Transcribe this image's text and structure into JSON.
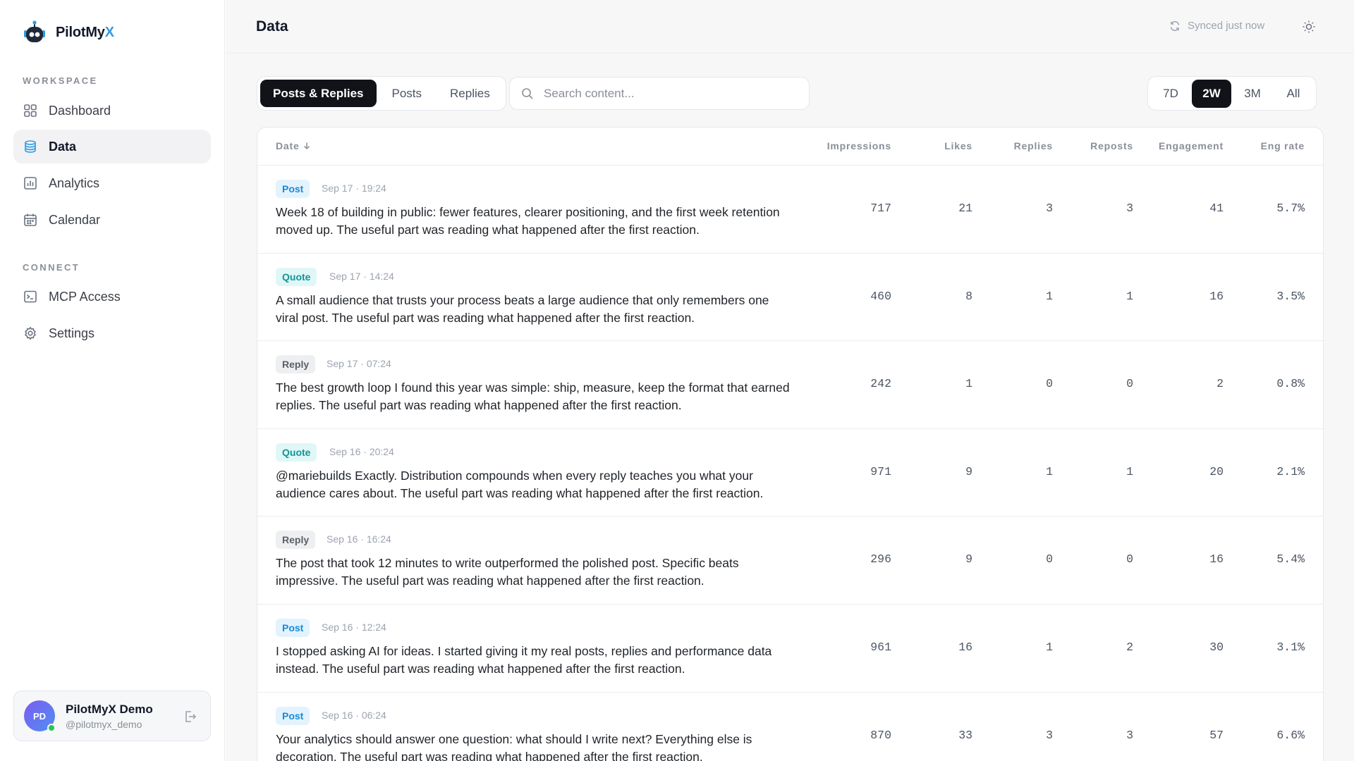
{
  "app": {
    "name_main": "PilotMy",
    "name_accent": "X",
    "accent_color": "#2d9be3"
  },
  "sidebar": {
    "workspace_label": "WORKSPACE",
    "connect_label": "CONNECT",
    "items": [
      {
        "label": "Dashboard",
        "icon": "grid-icon"
      },
      {
        "label": "Data",
        "icon": "database-icon",
        "active": true
      },
      {
        "label": "Analytics",
        "icon": "bar-chart-icon"
      },
      {
        "label": "Calendar",
        "icon": "calendar-icon"
      },
      {
        "label": "MCP Access",
        "icon": "terminal-icon"
      },
      {
        "label": "Settings",
        "icon": "gear-icon"
      }
    ],
    "user": {
      "initials": "PD",
      "name": "PilotMyX Demo",
      "handle": "@pilotmyx_demo",
      "status": "online"
    }
  },
  "header": {
    "title": "Data",
    "sync_status": "Synced just now"
  },
  "filters": {
    "tabs": [
      "Posts & Replies",
      "Posts",
      "Replies"
    ],
    "active_tab": "Posts & Replies",
    "search_placeholder": "Search content...",
    "search_value": "",
    "ranges": [
      "7D",
      "2W",
      "3M",
      "All"
    ],
    "active_range": "2W"
  },
  "table": {
    "columns": {
      "date": "Date",
      "impressions": "Impressions",
      "likes": "Likes",
      "replies": "Replies",
      "reposts": "Reposts",
      "engagement": "Engagement",
      "eng_rate": "Eng rate"
    },
    "sort": "date-desc",
    "rows": [
      {
        "type": "Post",
        "time": "Sep 17 · 19:24",
        "text": "Week 18 of building in public: fewer features, clearer positioning, and the first week retention moved up. The useful part was reading what happened after the first reaction.",
        "impressions": "717",
        "likes": "21",
        "replies": "3",
        "reposts": "3",
        "engagement": "41",
        "eng_rate": "5.7%"
      },
      {
        "type": "Quote",
        "time": "Sep 17 · 14:24",
        "text": "A small audience that trusts your process beats a large audience that only remembers one viral post. The useful part was reading what happened after the first reaction.",
        "impressions": "460",
        "likes": "8",
        "replies": "1",
        "reposts": "1",
        "engagement": "16",
        "eng_rate": "3.5%"
      },
      {
        "type": "Reply",
        "time": "Sep 17 · 07:24",
        "text": "The best growth loop I found this year was simple: ship, measure, keep the format that earned replies. The useful part was reading what happened after the first reaction.",
        "impressions": "242",
        "likes": "1",
        "replies": "0",
        "reposts": "0",
        "engagement": "2",
        "eng_rate": "0.8%"
      },
      {
        "type": "Quote",
        "time": "Sep 16 · 20:24",
        "text": "@mariebuilds Exactly. Distribution compounds when every reply teaches you what your audience cares about. The useful part was reading what happened after the first reaction.",
        "impressions": "971",
        "likes": "9",
        "replies": "1",
        "reposts": "1",
        "engagement": "20",
        "eng_rate": "2.1%"
      },
      {
        "type": "Reply",
        "time": "Sep 16 · 16:24",
        "text": "The post that took 12 minutes to write outperformed the polished post. Specific beats impressive. The useful part was reading what happened after the first reaction.",
        "impressions": "296",
        "likes": "9",
        "replies": "0",
        "reposts": "0",
        "engagement": "16",
        "eng_rate": "5.4%"
      },
      {
        "type": "Post",
        "time": "Sep 16 · 12:24",
        "text": "I stopped asking AI for ideas. I started giving it my real posts, replies and performance data instead. The useful part was reading what happened after the first reaction.",
        "impressions": "961",
        "likes": "16",
        "replies": "1",
        "reposts": "2",
        "engagement": "30",
        "eng_rate": "3.1%"
      },
      {
        "type": "Post",
        "time": "Sep 16 · 06:24",
        "text": "Your analytics should answer one question: what should I write next? Everything else is decoration. The useful part was reading what happened after the first reaction.",
        "impressions": "870",
        "likes": "33",
        "replies": "3",
        "reposts": "3",
        "engagement": "57",
        "eng_rate": "6.6%"
      }
    ]
  }
}
